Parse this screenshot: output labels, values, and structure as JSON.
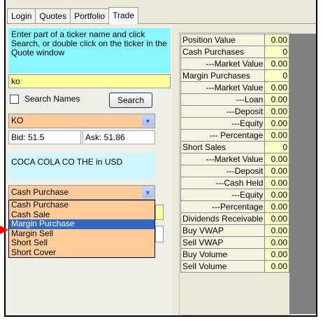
{
  "tabs": [
    {
      "label": "Login"
    },
    {
      "label": "Quotes"
    },
    {
      "label": "Portfolio"
    },
    {
      "label": "Trade",
      "active": true
    }
  ],
  "trade": {
    "hint": "Enter part of a ticker name and click Search, or double click on the ticker in the Quote window",
    "ticker_input_value": "ko",
    "search_names_label": "Search Names",
    "search_names_checked": false,
    "search_button": "Search",
    "selected_ticker": "KO",
    "bid": "Bid: 51.5",
    "ask": "Ask: 51.86",
    "description": "COCA COLA CO THE in USD",
    "order_type_selected": "Cash Purchase",
    "order_type_options": [
      {
        "label": "Cash Purchase"
      },
      {
        "label": "Cash Sale"
      },
      {
        "label": "Margin Purchase",
        "highlighted": true
      },
      {
        "label": "Margin Sell"
      },
      {
        "label": "Short Sell"
      },
      {
        "label": "Short Cover"
      }
    ]
  },
  "positions": [
    {
      "label": "Position Value",
      "value": "0.00",
      "indent": false
    },
    {
      "label": "Cash Purchases",
      "value": "0",
      "indent": false
    },
    {
      "label": "---Market Value",
      "value": "0.00",
      "indent": true
    },
    {
      "label": "Margin Purchases",
      "value": "0",
      "indent": false
    },
    {
      "label": "---Market Value",
      "value": "0.00",
      "indent": true
    },
    {
      "label": "---Loan",
      "value": "0.00",
      "indent": true
    },
    {
      "label": "---Deposit",
      "value": "0.00",
      "indent": true
    },
    {
      "label": "---Equity",
      "value": "0.00",
      "indent": true
    },
    {
      "label": "--- Percentage",
      "value": "0.00",
      "indent": true
    },
    {
      "label": "Short Sales",
      "value": "0",
      "indent": false
    },
    {
      "label": "---Market Value",
      "value": "0.00",
      "indent": true
    },
    {
      "label": "---Deposit",
      "value": "0.00",
      "indent": true
    },
    {
      "label": "---Cash Held",
      "value": "0.00",
      "indent": true
    },
    {
      "label": "---Equity",
      "value": "0.00",
      "indent": true
    },
    {
      "label": "---Percentage",
      "value": "0.00",
      "indent": true
    },
    {
      "label": "Dividends Receivable",
      "value": "0.00",
      "indent": false
    },
    {
      "label": "Buy VWAP",
      "value": "0.00",
      "indent": false
    },
    {
      "label": "Sell VWAP",
      "value": "0.00",
      "indent": false
    },
    {
      "label": "Buy Volume",
      "value": "0.00",
      "indent": false
    },
    {
      "label": "Sell Volume",
      "value": "0.00",
      "indent": false
    }
  ],
  "colors": {
    "hint_bg": "#8af7ff",
    "input_yellow": "#ffff99",
    "select_orange": "#ffcc99",
    "highlight": "#316ac5",
    "arrow": "#ff0000"
  }
}
